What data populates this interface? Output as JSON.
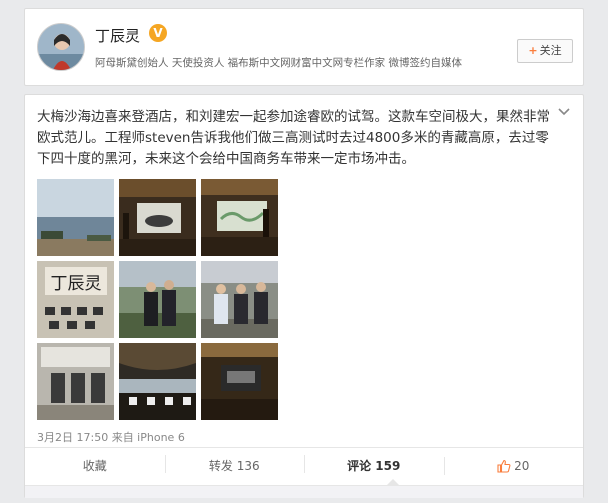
{
  "profile": {
    "name": "丁辰灵",
    "verified_icon": "V",
    "bio": "阿母斯黛创始人 天使投资人 福布斯中文网财富中文网专栏作家 微博签约自媒体",
    "follow_label": "关注",
    "follow_plus": "+"
  },
  "post": {
    "text": "大梅沙海边喜来登酒店，和刘建宏一起参加途睿欧的试驾。这款车空间极大，果然非常欧式范儿。工程师steven告诉我他们做三高测试时去过4800多米的青藏高原，去过零下四十度的黑河，未来这个会给中国商务车带来一定市场冲击。",
    "meta": "3月2日 17:50 来自 iPhone 6",
    "photo_grid_top_label": "丁辰灵"
  },
  "actions": {
    "favorite": "收藏",
    "repost": "转发 136",
    "comment": "评论 159",
    "like": "20"
  },
  "colors": {
    "accent": "#fa7d3c",
    "verified": "#f5a623"
  }
}
